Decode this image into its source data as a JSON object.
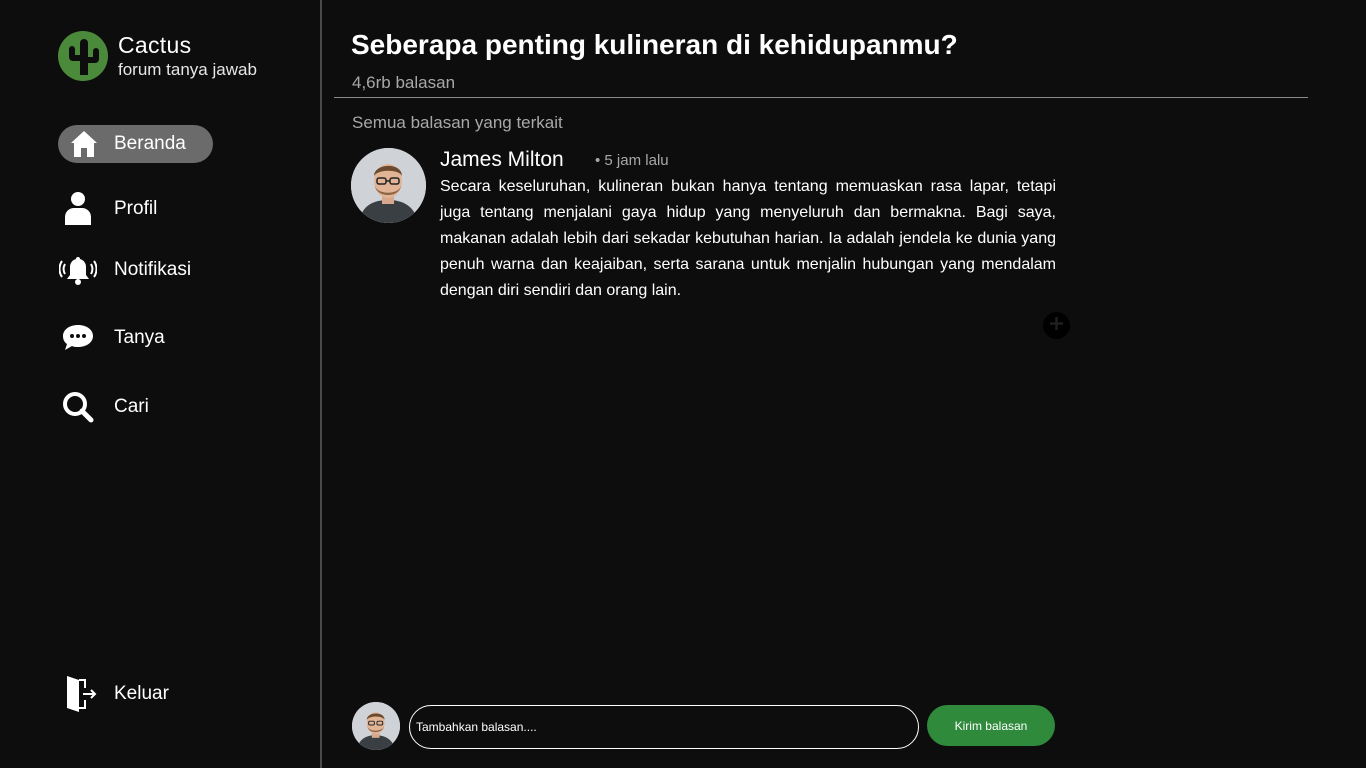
{
  "brand": {
    "name": "Cactus",
    "tagline": "forum tanya jawab",
    "logo_color": "#4a8a3a"
  },
  "sidebar": {
    "items": [
      {
        "label": "Beranda",
        "icon": "home-icon",
        "active": true
      },
      {
        "label": "Profil",
        "icon": "user-icon"
      },
      {
        "label": "Notifikasi",
        "icon": "bell-icon"
      },
      {
        "label": "Tanya",
        "icon": "chat-bubble-icon"
      },
      {
        "label": "Cari",
        "icon": "search-icon"
      }
    ],
    "logout": {
      "label": "Keluar",
      "icon": "logout-door-icon"
    }
  },
  "question": {
    "title": "Seberapa penting kulineran di kehidupanmu?",
    "reply_count": "4,6rb balasan"
  },
  "replies_section": {
    "label": "Semua balasan yang terkait"
  },
  "replies": [
    {
      "author": "James Milton",
      "time": "• 5 jam lalu",
      "body": "Secara keseluruhan, kulineran bukan hanya tentang memuaskan rasa lapar, tetapi juga tentang menjalani gaya hidup yang menyeluruh dan bermakna. Bagi saya, makanan adalah lebih dari sekadar kebutuhan harian. Ia adalah jendela ke dunia yang penuh warna dan keajaiban, serta sarana untuk menjalin hubungan yang mendalam dengan diri sendiri dan orang lain."
    }
  ],
  "composer": {
    "placeholder": "Tambahkan balasan....",
    "value": "",
    "submit_label": "Kirim balasan"
  },
  "colors": {
    "accent": "#2f8a3c",
    "active_nav": "#6b6b6b",
    "background": "#0d0d0d"
  }
}
